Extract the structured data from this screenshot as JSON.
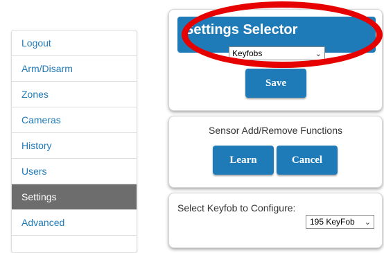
{
  "sidebar": {
    "items": [
      {
        "label": "Logout",
        "active": false
      },
      {
        "label": "Arm/Disarm",
        "active": false
      },
      {
        "label": "Zones",
        "active": false
      },
      {
        "label": "Cameras",
        "active": false
      },
      {
        "label": "History",
        "active": false
      },
      {
        "label": "Users",
        "active": false
      },
      {
        "label": "Settings",
        "active": true
      },
      {
        "label": "Advanced",
        "active": false
      }
    ]
  },
  "settings_selector": {
    "title": "Settings Selector",
    "selected": "Keyfobs",
    "save_label": "Save"
  },
  "sensor_functions": {
    "title": "Sensor Add/Remove Functions",
    "learn_label": "Learn",
    "cancel_label": "Cancel"
  },
  "keyfob_config": {
    "label": "Select Keyfob to Configure:",
    "selected": "195 KeyFob"
  },
  "colors": {
    "accent": "#1f7ab8",
    "active_nav": "#6d6d6d",
    "annotation": "#e60000"
  },
  "icons": {
    "dropdown": "chevron-down-icon"
  }
}
